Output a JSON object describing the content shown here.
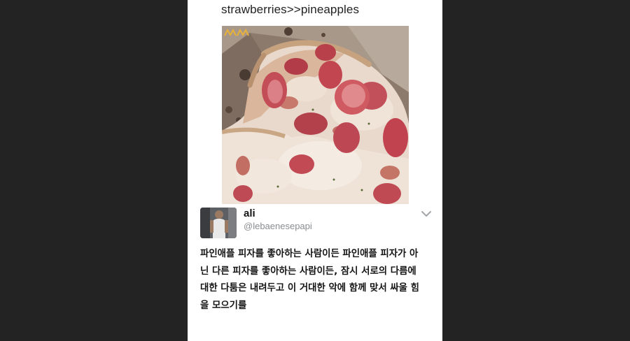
{
  "quoted_tweet": {
    "text": "strawberries>>pineapples",
    "image": "pizza-with-strawberries-photo"
  },
  "tweet": {
    "author": {
      "display_name": "ali",
      "handle": "@lebaenesepapi",
      "avatar": "avatar-photo"
    },
    "menu_icon": "chevron-down-icon",
    "body_lines": [
      "파인애플 피자를 좋아하는 사람이든 파인애플 피자가 아",
      "닌 다른 피자를 좋아하는 사람이든, 잠시 서로의 다름에",
      "대한 다툼은 내려두고 이 거대한 악에 함께 맞서 싸울 힘",
      "을 모으기를"
    ]
  },
  "colors": {
    "background": "#232323",
    "card": "#ffffff",
    "handle": "#8a8d91",
    "text": "#141414"
  }
}
